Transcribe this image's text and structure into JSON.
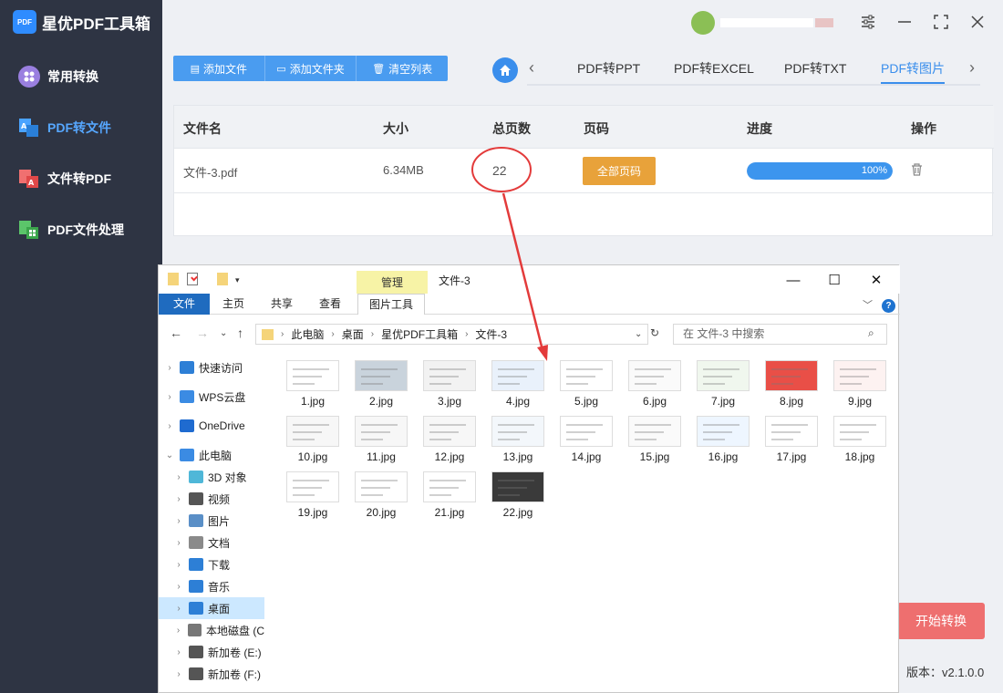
{
  "app": {
    "title": "星优PDF工具箱",
    "version": "版本：v2.1.0.0",
    "accent": "#3a8eec",
    "sidebar_bg": "#2e3443"
  },
  "sidebar": {
    "items": [
      {
        "label": "常用转换",
        "icon": "grid-icon",
        "active": false
      },
      {
        "label": "PDF转文件",
        "icon": "pdf-convert-icon",
        "active": true
      },
      {
        "label": "文件转PDF",
        "icon": "file-to-pdf-icon",
        "active": false
      },
      {
        "label": "PDF文件处理",
        "icon": "pdf-process-icon",
        "active": false
      }
    ]
  },
  "toolbar": {
    "add_file": "添加文件",
    "add_folder": "添加文件夹",
    "clear_list": "清空列表"
  },
  "tabs": [
    {
      "label": "PDF转PPT",
      "active": false
    },
    {
      "label": "PDF转EXCEL",
      "active": false
    },
    {
      "label": "PDF转TXT",
      "active": false
    },
    {
      "label": "PDF转图片",
      "active": true
    }
  ],
  "table": {
    "headers": [
      "文件名",
      "大小",
      "总页数",
      "页码",
      "进度",
      "操作"
    ],
    "rows": [
      {
        "name": "文件-3.pdf",
        "size": "6.34MB",
        "pages": "22",
        "page_button": "全部页码",
        "progress": 1.0,
        "progress_text": "100%"
      }
    ]
  },
  "start_button": "开始转换",
  "explorer": {
    "manage_tab": "管理",
    "window_title": "文件-3",
    "ribbon_tabs": [
      "文件",
      "主页",
      "共享",
      "查看",
      "图片工具"
    ],
    "path": [
      "此电脑",
      "桌面",
      "星优PDF工具箱",
      "文件-3"
    ],
    "search_placeholder": "在 文件-3 中搜索",
    "nav": [
      {
        "label": "快速访问",
        "icon": "star-icon",
        "level": 0
      },
      {
        "label": "WPS云盘",
        "icon": "cloud-icon",
        "level": 0
      },
      {
        "label": "OneDrive",
        "icon": "onedrive-icon",
        "level": 0
      },
      {
        "label": "此电脑",
        "icon": "computer-icon",
        "level": 0
      },
      {
        "label": "3D 对象",
        "icon": "cube-icon",
        "level": 1
      },
      {
        "label": "视频",
        "icon": "video-icon",
        "level": 1
      },
      {
        "label": "图片",
        "icon": "picture-icon",
        "level": 1
      },
      {
        "label": "文档",
        "icon": "document-icon",
        "level": 1
      },
      {
        "label": "下载",
        "icon": "download-icon",
        "level": 1
      },
      {
        "label": "音乐",
        "icon": "music-icon",
        "level": 1
      },
      {
        "label": "桌面",
        "icon": "desktop-icon",
        "level": 1,
        "selected": true
      },
      {
        "label": "本地磁盘 (C",
        "icon": "disk-icon",
        "level": 1
      },
      {
        "label": "新加卷 (E:)",
        "icon": "drive-icon",
        "level": 1
      },
      {
        "label": "新加卷 (F:)",
        "icon": "drive-icon",
        "level": 1
      }
    ],
    "files": [
      "1.jpg",
      "2.jpg",
      "3.jpg",
      "4.jpg",
      "5.jpg",
      "6.jpg",
      "7.jpg",
      "8.jpg",
      "9.jpg",
      "10.jpg",
      "11.jpg",
      "12.jpg",
      "13.jpg",
      "14.jpg",
      "15.jpg",
      "16.jpg",
      "17.jpg",
      "18.jpg",
      "19.jpg",
      "20.jpg",
      "21.jpg",
      "22.jpg"
    ]
  }
}
